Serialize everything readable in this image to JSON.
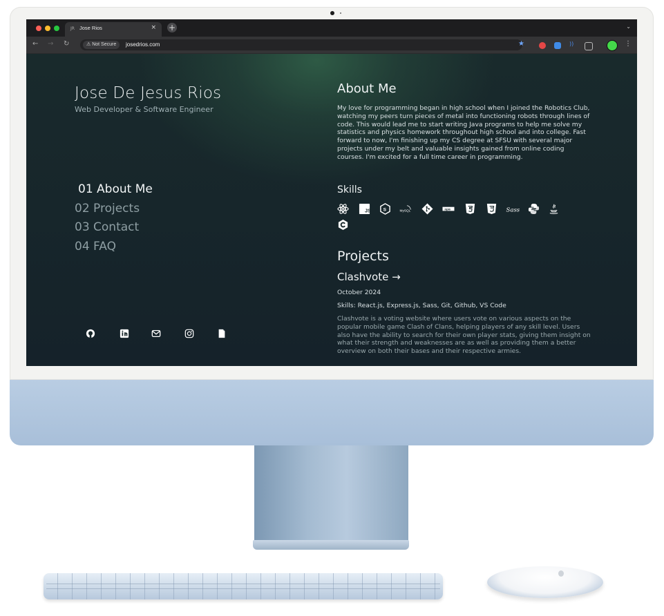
{
  "browser": {
    "tab_title": "Jose Rios",
    "tab_favicon": "JR",
    "tab_close": "×",
    "new_tab": "+",
    "security_label": "⚠ Not Secure",
    "url": "josedrios.com",
    "colors": {
      "profile": "#44d94a",
      "bookmark": "#6fa6ff"
    }
  },
  "site": {
    "name": "Jose De Jesus Rios",
    "subtitle": "Web Developer & Software Engineer",
    "nav": [
      {
        "label": "01 About Me",
        "active": true
      },
      {
        "label": "02 Projects",
        "active": false
      },
      {
        "label": "03 Contact",
        "active": false
      },
      {
        "label": "04 FAQ",
        "active": false
      }
    ],
    "socials": [
      "github-icon",
      "linkedin-icon",
      "mail-icon",
      "instagram-icon",
      "resume-file-icon"
    ],
    "about": {
      "heading": "About Me",
      "text": "My love for programming began in high school when I joined the Robotics Club, watching my peers turn pieces of metal into functioning robots through lines of code. This would lead me to start writing Java programs to help me solve my statistics and physics homework throughout high school and into college. Fast forward to now, I'm finishing up my CS degree at SFSU with several major projects under my belt and valuable insights gained from online coding courses. I'm excited for a full time career in programming."
    },
    "skills": {
      "heading": "Skills",
      "icons": [
        "react-icon",
        "javascript-icon",
        "nodejs-icon",
        "mysql-icon",
        "git-icon",
        "npm-icon",
        "html5-icon",
        "css3-icon",
        "sass-icon",
        "python-icon",
        "java-icon",
        "c-icon"
      ],
      "badge_text": {
        "js": "JS",
        "mysql": "MySQL",
        "npm": "npm",
        "sass": "Sass"
      }
    },
    "projects": {
      "heading": "Projects",
      "items": [
        {
          "title": "Clashvote →",
          "date": "October 2024",
          "skills": "Skills: React.js, Express.js, Sass, Git, Github, VS Code",
          "description": "Clashvote is a voting website where users vote on various aspects on the popular mobile game Clash of Clans, helping players of any skill level. Users also have the ability to search for their own player stats, giving them insight on what their strength and weaknesses are as well as providing them a better overview on both their bases and their respective armies."
        }
      ]
    }
  }
}
